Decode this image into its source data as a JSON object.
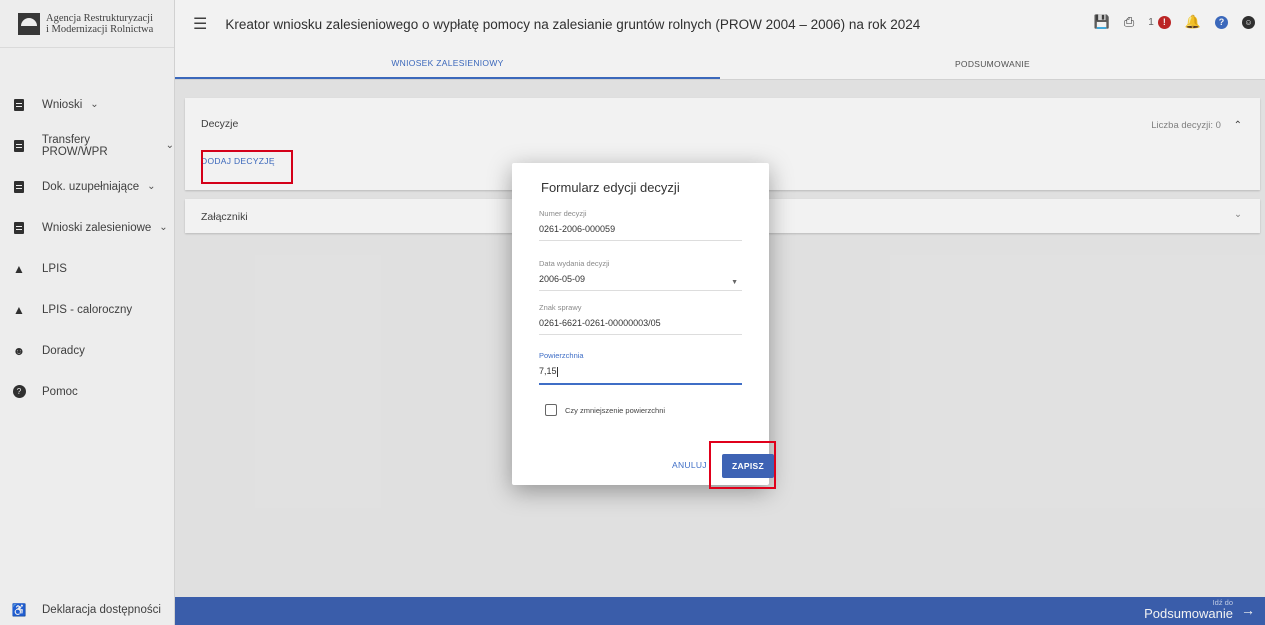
{
  "logo": {
    "line1": "Agencja Restrukturyzacji",
    "line2": "i Modernizacji Rolnictwa"
  },
  "header": {
    "title": "Kreator wniosku zalesieniowego o wypłatę pomocy na zalesianie gruntów rolnych (PROW 2004 – 2006) na rok 2024",
    "alert_count": "1"
  },
  "sidebar": {
    "items": [
      {
        "label": "Wnioski",
        "icon": "document-icon",
        "expandable": true
      },
      {
        "label": "Transfery PROW/WPR",
        "icon": "document-icon",
        "expandable": true
      },
      {
        "label": "Dok. uzupełniające",
        "icon": "document-icon",
        "expandable": true
      },
      {
        "label": "Wnioski zalesieniowe",
        "icon": "document-icon",
        "expandable": true
      },
      {
        "label": "LPIS",
        "icon": "terrain-icon",
        "expandable": false
      },
      {
        "label": "LPIS - caloroczny",
        "icon": "terrain-icon",
        "expandable": false
      },
      {
        "label": "Doradcy",
        "icon": "person-icon",
        "expandable": false
      },
      {
        "label": "Pomoc",
        "icon": "help-icon",
        "expandable": false
      }
    ],
    "accessibility": "Deklaracja dostępności"
  },
  "tabs": [
    {
      "label": "WNIOSEK ZALESIENIOWY",
      "active": true
    },
    {
      "label": "PODSUMOWANIE",
      "active": false
    }
  ],
  "panels": {
    "decisions": {
      "title": "Decyzje",
      "count_label": "Liczba decyzji: 0",
      "add_button": "DODAJ DECYZJĘ"
    },
    "attachments": {
      "title": "Załączniki"
    }
  },
  "dialog": {
    "title": "Formularz edycji decyzji",
    "fields": {
      "number": {
        "label": "Numer decyzji",
        "value": "0261-2006-000059"
      },
      "date": {
        "label": "Data wydania decyzji",
        "value": "2006-05-09"
      },
      "case": {
        "label": "Znak sprawy",
        "value": "0261-6621-0261-00000003/05"
      },
      "area": {
        "label": "Powierzchnia",
        "value": "7,15"
      }
    },
    "checkbox_label": "Czy zmniejszenie powierzchni",
    "cancel_label": "ANULUJ",
    "save_label": "ZAPISZ"
  },
  "footer": {
    "goto_small": "Idź do",
    "goto_label": "Podsumowanie"
  },
  "colors": {
    "accent": "#3f6ec6",
    "bottombar": "#3e63b4",
    "highlight": "#e0001b",
    "alert": "#c62828"
  }
}
